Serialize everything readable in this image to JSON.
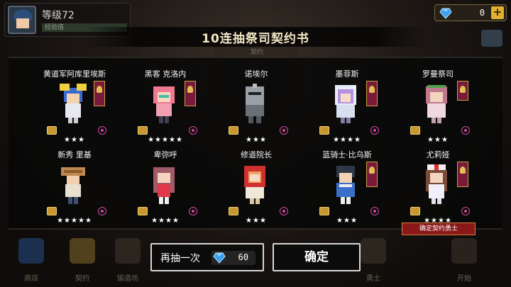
{
  "hud": {
    "level": "等级72",
    "exp_text": "经验值"
  },
  "currency": {
    "icon": "diamond-icon",
    "value": "0"
  },
  "title": "10连抽祭司契约书",
  "subtitle": "契约",
  "heroes": [
    {
      "name": "黄道军阿库里埃斯",
      "stars": "★★★"
    },
    {
      "name": "黑客 克洛内",
      "stars": "★★★★★"
    },
    {
      "name": "诺埃尔",
      "stars": "★★★"
    },
    {
      "name": "墨菲斯",
      "stars": "★★★★"
    },
    {
      "name": "罗曼祭司",
      "stars": "★★★"
    },
    {
      "name": "新秀 里基",
      "stars": "★★★★★"
    },
    {
      "name": "卑弥呼",
      "stars": "★★★★"
    },
    {
      "name": "修道院长",
      "stars": "★★★"
    },
    {
      "name": "蓝骑士·比乌斯",
      "stars": "★★★"
    },
    {
      "name": "尤莉娅",
      "stars": "★★★★"
    }
  ],
  "confirm_tag": "确定契约勇士",
  "buttons": {
    "again_label": "再抽一次",
    "again_cost": "60",
    "ok_label": "确定"
  },
  "nav": [
    {
      "label": "商店",
      "icon": "shop-gem-icon"
    },
    {
      "label": "契约",
      "icon": "contract-icon"
    },
    {
      "label": "锻造坊",
      "icon": "forge-icon"
    },
    {
      "label": "",
      "icon": "adventure-icon"
    },
    {
      "label": "",
      "icon": "dungeon-icon"
    },
    {
      "label": "",
      "icon": "arena-icon"
    },
    {
      "label": "",
      "icon": "guild-icon"
    },
    {
      "label": "勇士",
      "icon": "hero-helmet-icon"
    },
    {
      "label": "开始",
      "icon": "start-icon"
    }
  ]
}
